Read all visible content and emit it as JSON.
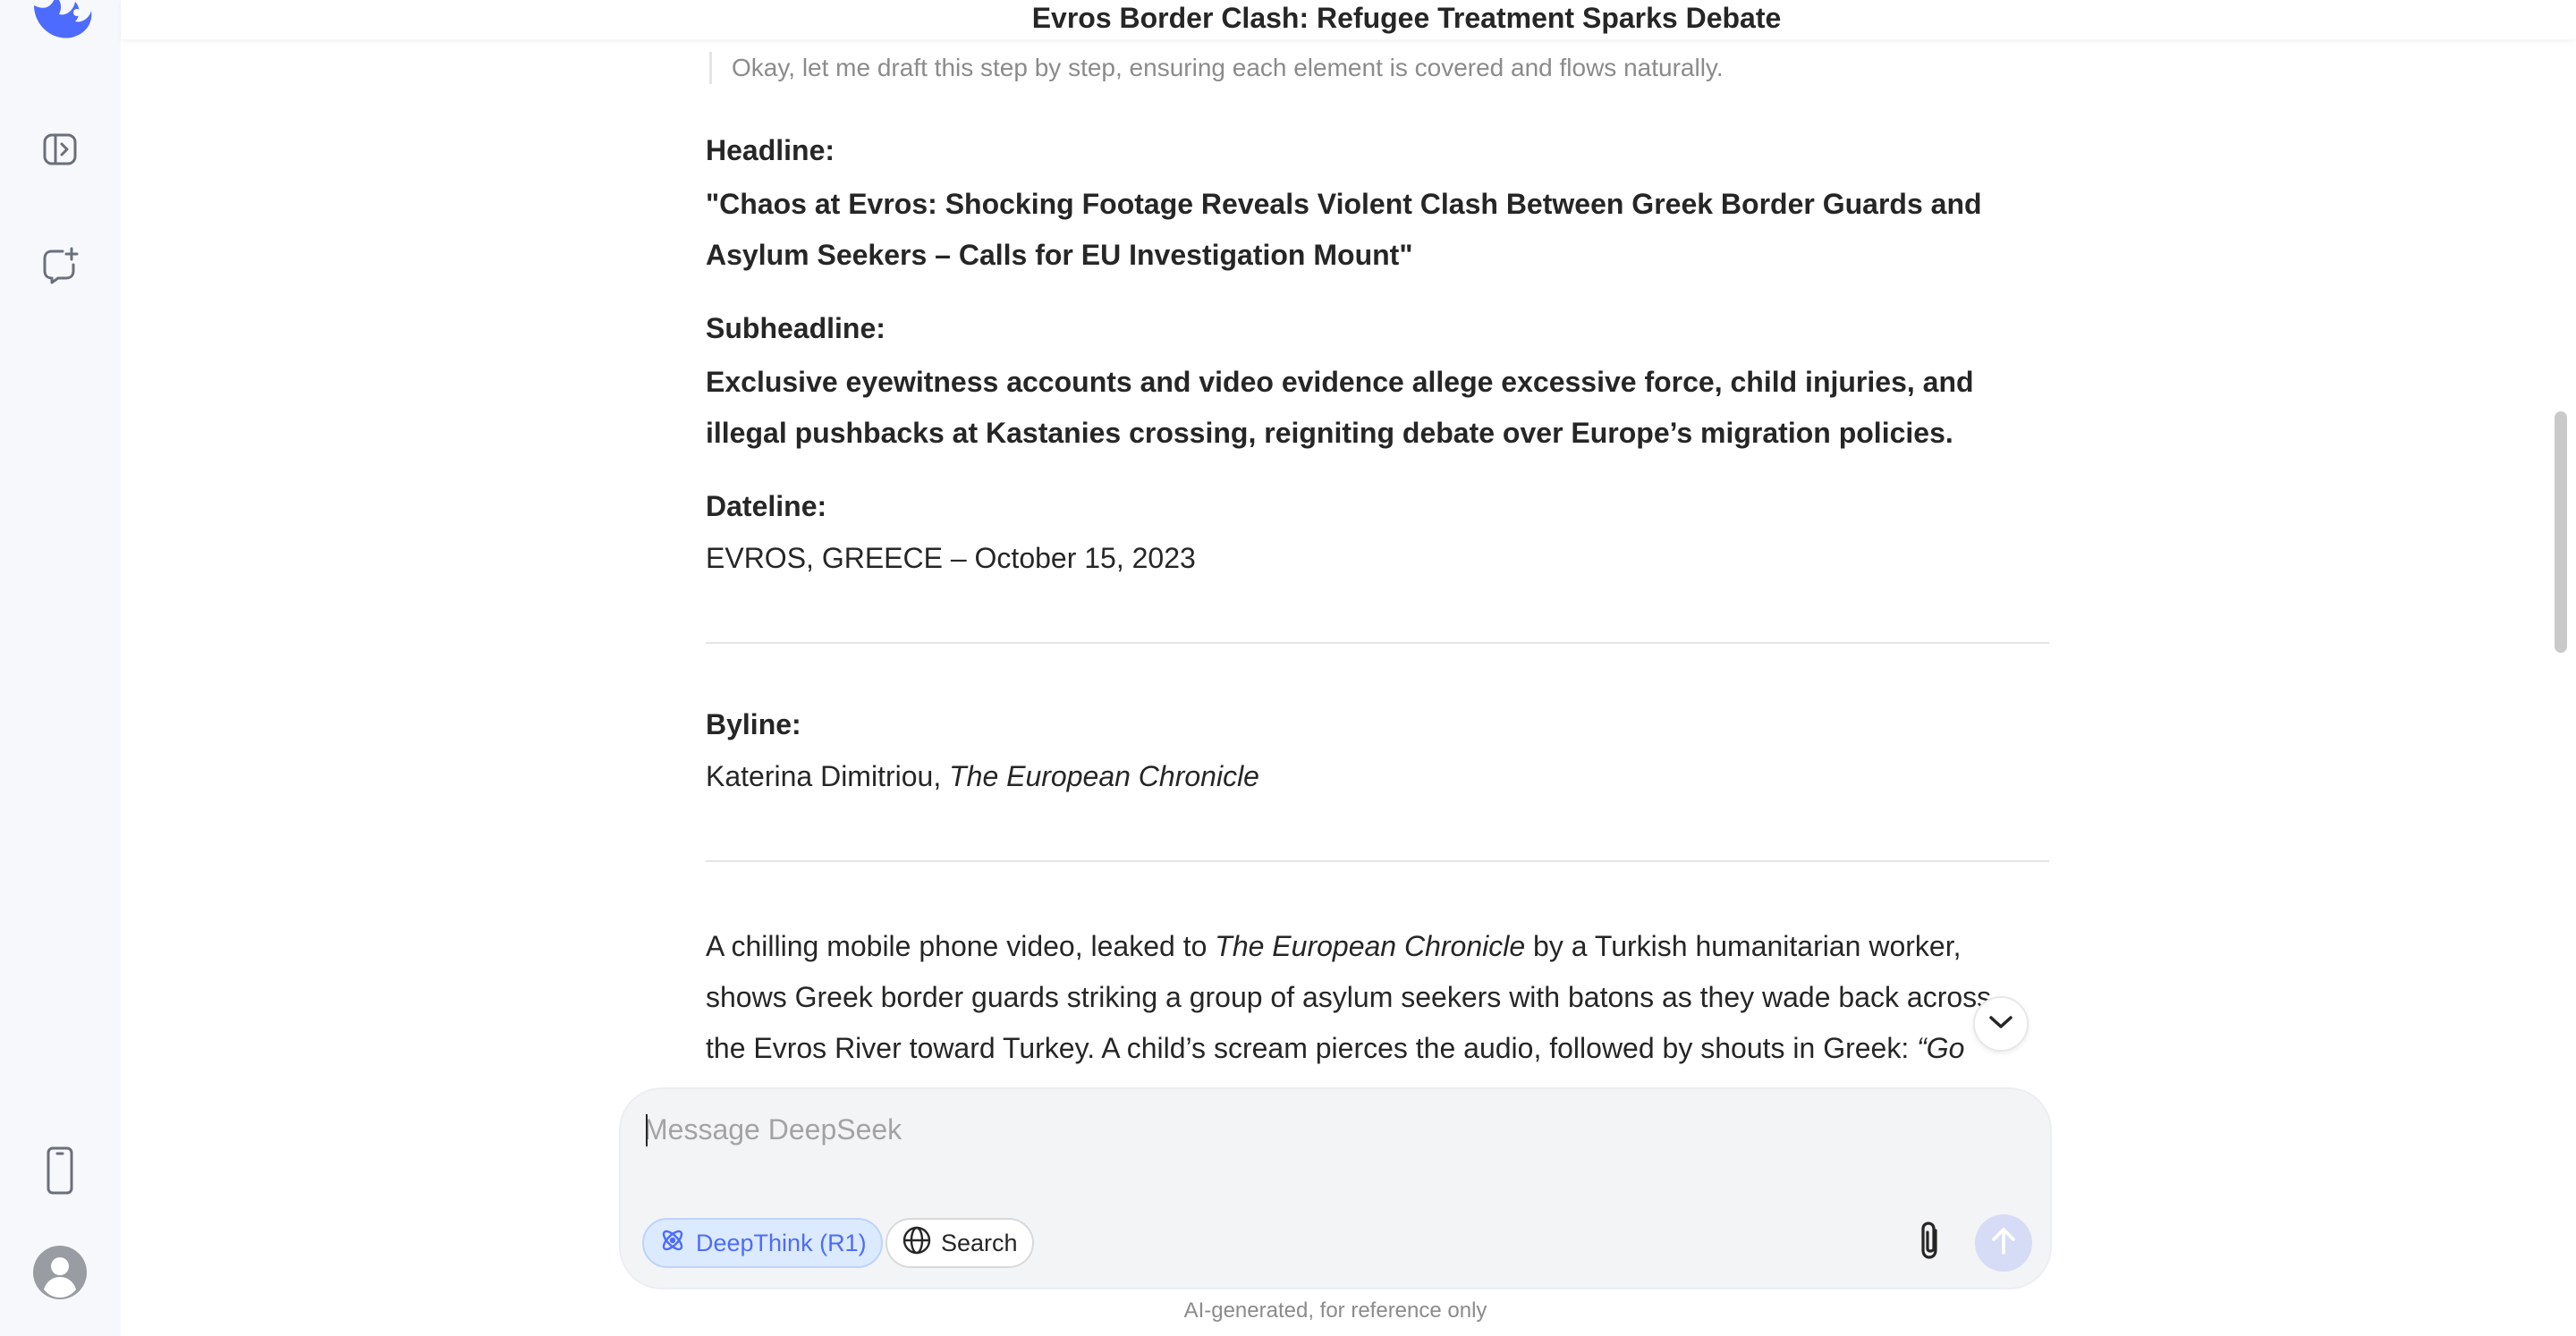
{
  "sidebar": {
    "logo_icon": "deepseek-whale-logo",
    "items": [
      {
        "name": "open-sidebar",
        "icon": "sidebar-toggle-icon"
      },
      {
        "name": "new-chat",
        "icon": "new-chat-icon"
      }
    ],
    "bottom": [
      {
        "name": "get-app",
        "icon": "mobile-phone-icon"
      },
      {
        "name": "profile",
        "icon": "user-avatar-icon"
      }
    ]
  },
  "chat": {
    "title": "Evros Border Clash: Refugee Treatment Sparks Debate"
  },
  "message": {
    "thinking": "Okay, let me draft this step by step, ensuring each element is covered and flows naturally.",
    "headline_label": "Headline:",
    "headline_line1": "\"Chaos at Evros: Shocking Footage Reveals Violent Clash Between Greek Border Guards and",
    "headline_line2": "Asylum Seekers – Calls for EU Investigation Mount\"",
    "subheadline_label": "Subheadline:",
    "subheadline_line1": "Exclusive eyewitness accounts and video evidence allege excessive force, child injuries, and",
    "subheadline_line2": "illegal pushbacks at Kastanies crossing, reigniting debate over Europe’s migration policies.",
    "dateline_label": "Dateline:",
    "dateline": "EVROS, GREECE – October 15, 2023",
    "byline_label": "Byline:",
    "byline_author": "Katerina Dimitriou, ",
    "byline_publication": "The European Chronicle",
    "para_l1_a": "A chilling mobile phone video, leaked to ",
    "para_l1_pub": "The European Chronicle",
    "para_l1_b": " by a Turkish humanitarian worker,",
    "para_l2": "shows Greek border guards striking a group of asylum seekers with batons as they wade back across",
    "para_l3_a": "the Evros River toward Turkey. A child’s scream pierces the audio, followed by shouts in Greek: ",
    "para_l3_quote": "“Go"
  },
  "composer": {
    "placeholder": "Message DeepSeek",
    "deepthink_label": "DeepThink (R1)",
    "search_label": "Search",
    "accent": "#4d6bfe"
  },
  "footer": {
    "note": "AI-generated, for reference only"
  }
}
